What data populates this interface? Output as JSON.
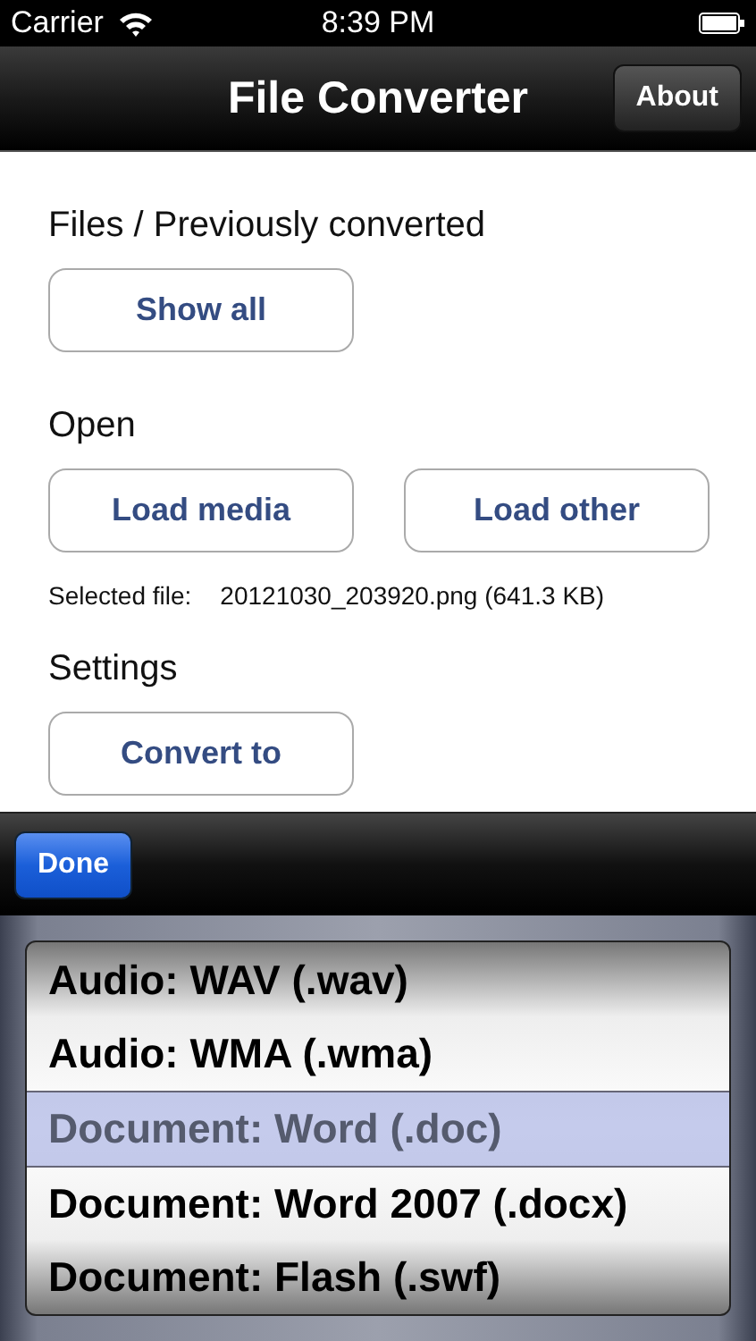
{
  "status_bar": {
    "carrier": "Carrier",
    "time": "8:39 PM"
  },
  "nav_bar": {
    "title": "File Converter",
    "button": "About"
  },
  "sections": [
    {
      "heading": "Files / Previously converted",
      "buttons": [
        "Show all"
      ]
    },
    {
      "heading": "Open",
      "buttons": [
        "Load media",
        "Load other"
      ],
      "note_label": "Selected file:",
      "note_value": "20121030_203920.png (641.3 KB)"
    },
    {
      "heading": "Settings",
      "buttons": [
        "Convert to"
      ]
    }
  ],
  "toolbar": {
    "button": "Done"
  },
  "picker": {
    "options": [
      {
        "label": "Audio: WAV (.wav)",
        "selected": false
      },
      {
        "label": "Audio: WMA (.wma)",
        "selected": false
      },
      {
        "label": "Document: Word (.doc)",
        "selected": true
      },
      {
        "label": "Document: Word 2007 (.docx)",
        "selected": false
      },
      {
        "label": "Document: Flash (.swf)",
        "selected": false
      }
    ]
  }
}
